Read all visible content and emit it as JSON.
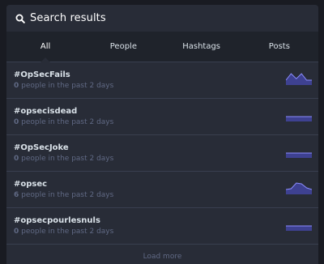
{
  "header": {
    "title": "Search results",
    "icon": "search-icon"
  },
  "tabs": [
    {
      "label": "All",
      "active": true
    },
    {
      "label": "People",
      "active": false
    },
    {
      "label": "Hashtags",
      "active": false
    },
    {
      "label": "Posts",
      "active": false
    }
  ],
  "results": [
    {
      "tag": "#OpSecFails",
      "count": "0",
      "suffix": " people in the past 2 days",
      "trend": [
        0,
        9,
        2,
        9,
        0,
        0
      ]
    },
    {
      "tag": "#opsecisdead",
      "count": "0",
      "suffix": " people in the past 2 days",
      "trend": [
        0,
        0,
        0,
        0,
        0,
        0
      ]
    },
    {
      "tag": "#OpSecJoke",
      "count": "0",
      "suffix": " people in the past 2 days",
      "trend": [
        0,
        0,
        0,
        0,
        0,
        0
      ]
    },
    {
      "tag": "#opsec",
      "count": "6",
      "suffix": " people in the past 2 days",
      "trend": [
        0,
        1,
        8,
        7,
        2,
        0
      ]
    },
    {
      "tag": "#opsecpourlesnuls",
      "count": "0",
      "suffix": " people in the past 2 days",
      "trend": [
        0,
        0,
        0,
        0,
        0,
        0
      ]
    }
  ],
  "load_more_label": "Load more",
  "colors": {
    "background": "#191b22",
    "panel": "#282c37",
    "tabs_bg": "#1f232b",
    "divider": "#393f4f",
    "primary_text": "#d9e1e8",
    "muted_text": "#606984",
    "sparkline_fill": "#595aff"
  }
}
